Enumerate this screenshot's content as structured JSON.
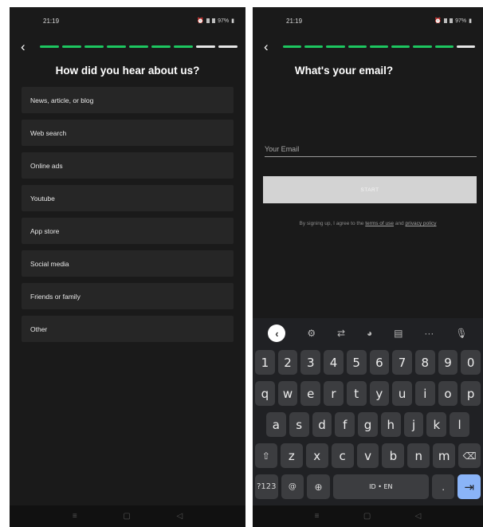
{
  "status": {
    "time": "21:19",
    "battery": "97%"
  },
  "left_screen": {
    "back_glyph": "‹",
    "progress": {
      "filled": 7,
      "empty": 2
    },
    "title": "How did you hear about us?",
    "options": [
      "News, article, or blog",
      "Web search",
      "Online ads",
      "Youtube",
      "App store",
      "Social media",
      "Friends or family",
      "Other"
    ]
  },
  "right_screen": {
    "back_glyph": "‹",
    "progress": {
      "filled": 8,
      "empty": 1
    },
    "title": "What's your email?",
    "email": {
      "value": "",
      "placeholder": "Your Email"
    },
    "start_label": "START",
    "terms": {
      "prefix": "By signing up, I agree to the",
      "terms_link": "terms of use",
      "middle": "and",
      "privacy_link": "privacy policy"
    }
  },
  "keyboard": {
    "tools": [
      "gear-icon",
      "translate-icon",
      "palette-icon",
      "clipboard-icon",
      "more-icon",
      "mic-off-icon"
    ],
    "row_numbers": [
      "1",
      "2",
      "3",
      "4",
      "5",
      "6",
      "7",
      "8",
      "9",
      "0"
    ],
    "row_q": [
      "q",
      "w",
      "e",
      "r",
      "t",
      "y",
      "u",
      "i",
      "o",
      "p"
    ],
    "row_a": [
      "a",
      "s",
      "d",
      "f",
      "g",
      "h",
      "j",
      "k",
      "l"
    ],
    "row_z": [
      "z",
      "x",
      "c",
      "v",
      "b",
      "n",
      "m"
    ],
    "symbols_label": "?123",
    "at_label": "@",
    "space_label": "ID • EN",
    "period_label": "."
  },
  "colors": {
    "accent": "#1dc660",
    "background": "#1a1a1a",
    "option_bg": "#262626",
    "button_disabled": "#d3d3d3"
  }
}
